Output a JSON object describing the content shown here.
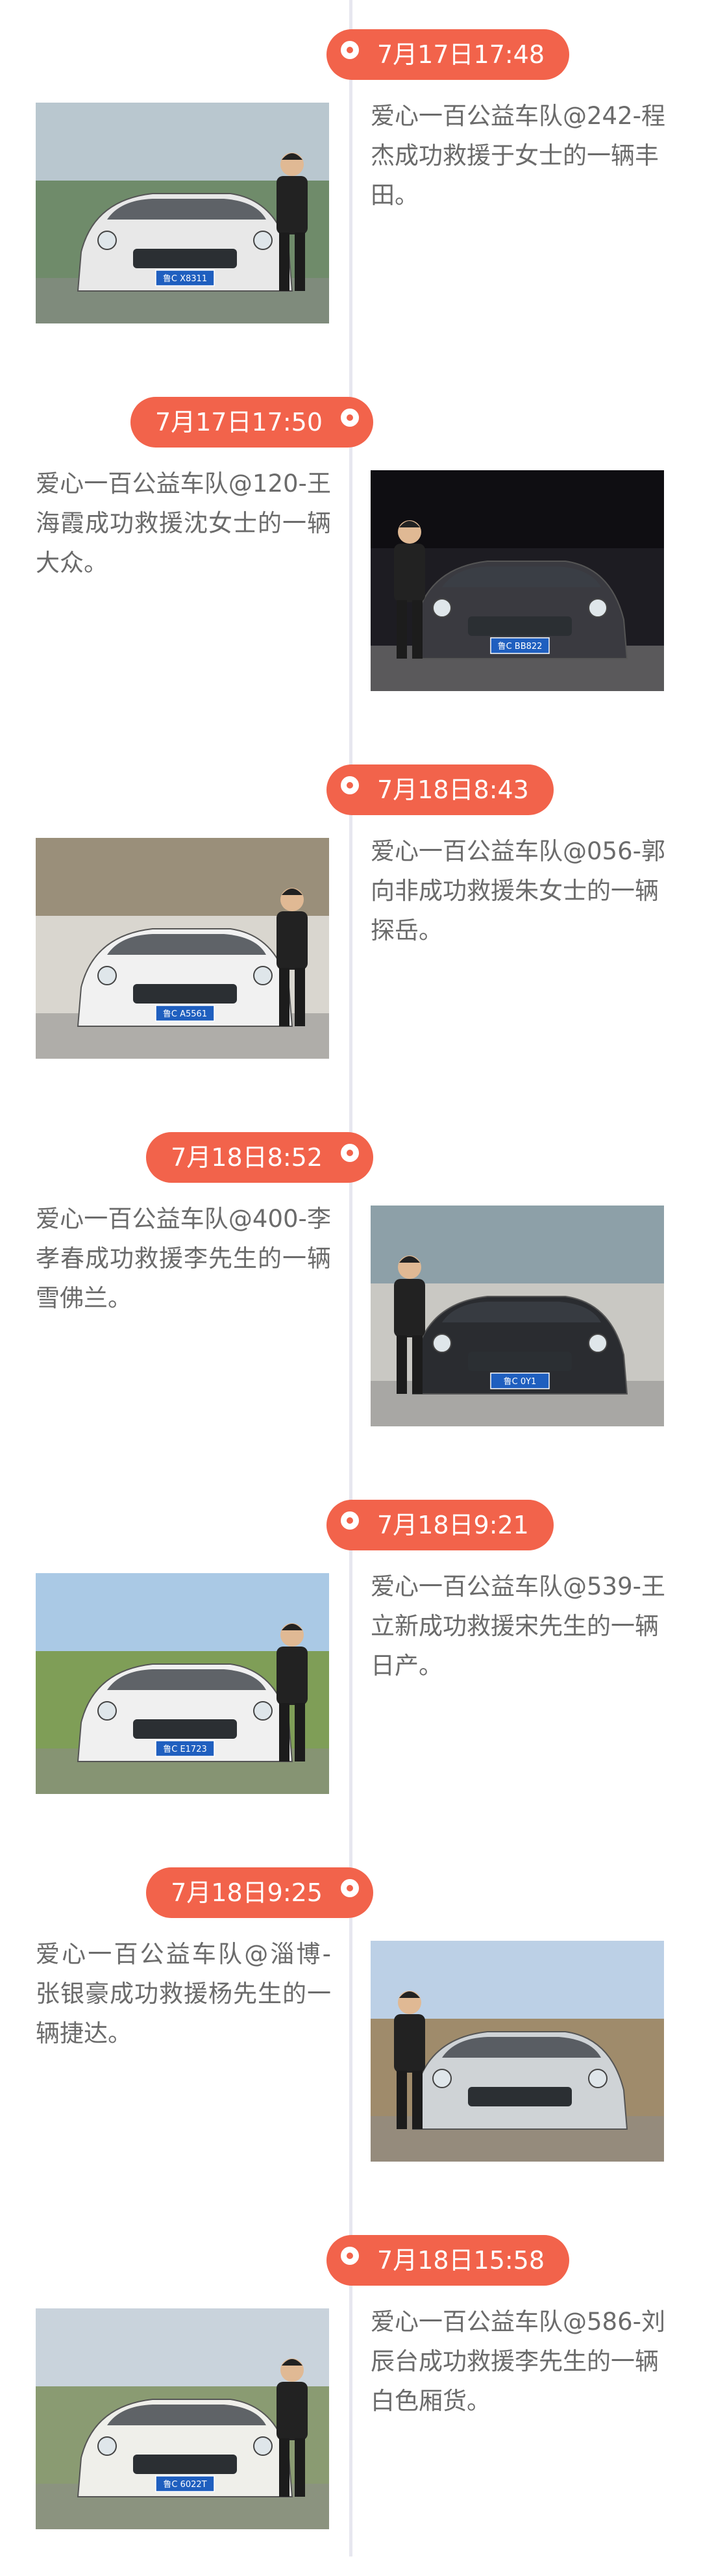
{
  "entries": [
    {
      "time": "7月17日17:48",
      "text": "爱心一百公益车队@242-程杰成功救援于女士的一辆丰田。",
      "plate": "鲁C X8311",
      "side": "right",
      "colors": {
        "bg": "#6f8b6a",
        "car": "#e8e8e8",
        "sky": "#b9c7cf"
      }
    },
    {
      "time": "7月17日17:50",
      "text": "爱心一百公益车队@120-王海霞成功救援沈女士的一辆大众。",
      "plate": "鲁C BB822",
      "side": "left",
      "colors": {
        "bg": "#1d1c22",
        "car": "#3a3a40",
        "sky": "#0f0e12"
      }
    },
    {
      "time": "7月18日8:43",
      "text": "爱心一百公益车队@056-郭向非成功救援朱女士的一辆探岳。",
      "plate": "鲁C A5561",
      "side": "right",
      "colors": {
        "bg": "#d9d6cf",
        "car": "#f1f1f1",
        "sky": "#9a8f7a"
      }
    },
    {
      "time": "7月18日8:52",
      "text": "爱心一百公益车队@400-李孝春成功救援李先生的一辆雪佛兰。",
      "plate": "鲁C 0Y1",
      "side": "left",
      "colors": {
        "bg": "#c9c8c3",
        "car": "#2a2c30",
        "sky": "#8da0a8"
      }
    },
    {
      "time": "7月18日9:21",
      "text": "爱心一百公益车队@539-王立新成功救援宋先生的一辆日产。",
      "plate": "鲁C E1723",
      "side": "right",
      "colors": {
        "bg": "#7f9e57",
        "car": "#f0f0f0",
        "sky": "#aac9e5"
      }
    },
    {
      "time": "7月18日9:25",
      "text": "爱心一百公益车队@淄博-张银豪成功救援杨先生的一辆捷达。",
      "plate": "",
      "side": "left",
      "colors": {
        "bg": "#9f8b6b",
        "car": "#cfd3d6",
        "sky": "#bcd0e6"
      }
    },
    {
      "time": "7月18日15:58",
      "text": "爱心一百公益车队@586-刘辰台成功救援李先生的一辆白色厢货。",
      "plate": "鲁C 6022T",
      "side": "right",
      "colors": {
        "bg": "#8a9b72",
        "car": "#efefea",
        "sky": "#c9d3dc"
      }
    }
  ]
}
